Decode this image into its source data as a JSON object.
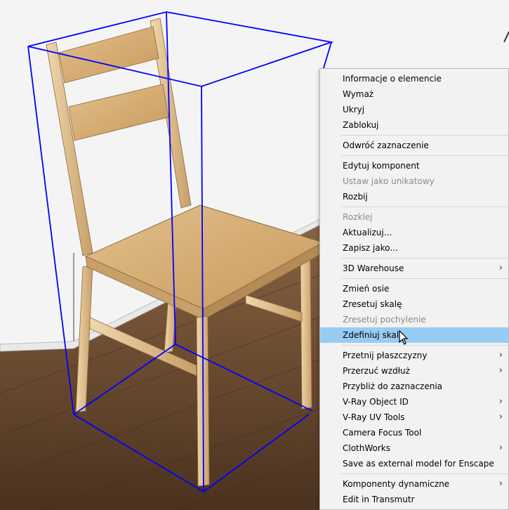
{
  "context_menu": {
    "groups": [
      [
        {
          "label": "Informacje o elemencie",
          "disabled": false,
          "submenu": false
        },
        {
          "label": "Wymaż",
          "disabled": false,
          "submenu": false
        },
        {
          "label": "Ukryj",
          "disabled": false,
          "submenu": false
        },
        {
          "label": "Zablokuj",
          "disabled": false,
          "submenu": false
        }
      ],
      [
        {
          "label": "Odwróć zaznaczenie",
          "disabled": false,
          "submenu": false
        }
      ],
      [
        {
          "label": "Edytuj komponent",
          "disabled": false,
          "submenu": false
        },
        {
          "label": "Ustaw jako unikatowy",
          "disabled": true,
          "submenu": false
        },
        {
          "label": "Rozbij",
          "disabled": false,
          "submenu": false
        }
      ],
      [
        {
          "label": "Rozklej",
          "disabled": true,
          "submenu": false
        },
        {
          "label": "Aktualizuj...",
          "disabled": false,
          "submenu": false
        },
        {
          "label": "Zapisz jako...",
          "disabled": false,
          "submenu": false
        }
      ],
      [
        {
          "label": "3D Warehouse",
          "disabled": false,
          "submenu": true
        }
      ],
      [
        {
          "label": "Zmień osie",
          "disabled": false,
          "submenu": false
        },
        {
          "label": "Zresetuj skalę",
          "disabled": false,
          "submenu": false
        },
        {
          "label": "Zresetuj pochylenie",
          "disabled": true,
          "submenu": false
        },
        {
          "label": "Zdefiniuj skalę",
          "disabled": false,
          "submenu": false,
          "hover": true
        }
      ],
      [
        {
          "label": "Przetnij płaszczyzny",
          "disabled": false,
          "submenu": true
        },
        {
          "label": "Przerzuć wzdłuż",
          "disabled": false,
          "submenu": true
        },
        {
          "label": "Przybliż do zaznaczenia",
          "disabled": false,
          "submenu": false
        },
        {
          "label": "V-Ray Object ID",
          "disabled": false,
          "submenu": true
        },
        {
          "label": "V-Ray UV Tools",
          "disabled": false,
          "submenu": true
        },
        {
          "label": "Camera Focus Tool",
          "disabled": false,
          "submenu": false
        },
        {
          "label": "ClothWorks",
          "disabled": false,
          "submenu": true
        },
        {
          "label": "Save as external model for Enscape",
          "disabled": false,
          "submenu": false
        }
      ],
      [
        {
          "label": "Komponenty dynamiczne",
          "disabled": false,
          "submenu": true
        },
        {
          "label": "Edit in Transmutr",
          "disabled": false,
          "submenu": false
        }
      ]
    ],
    "submenu_arrow": "›"
  },
  "colors": {
    "selection_box": "#0000ff",
    "menu_hover": "#99ccf3",
    "wall": "#f4f4f4",
    "floor": "#6b4a2e",
    "chair_wood": "#d9b27a"
  },
  "icons": {
    "cursor": "arrow-cursor-icon"
  }
}
